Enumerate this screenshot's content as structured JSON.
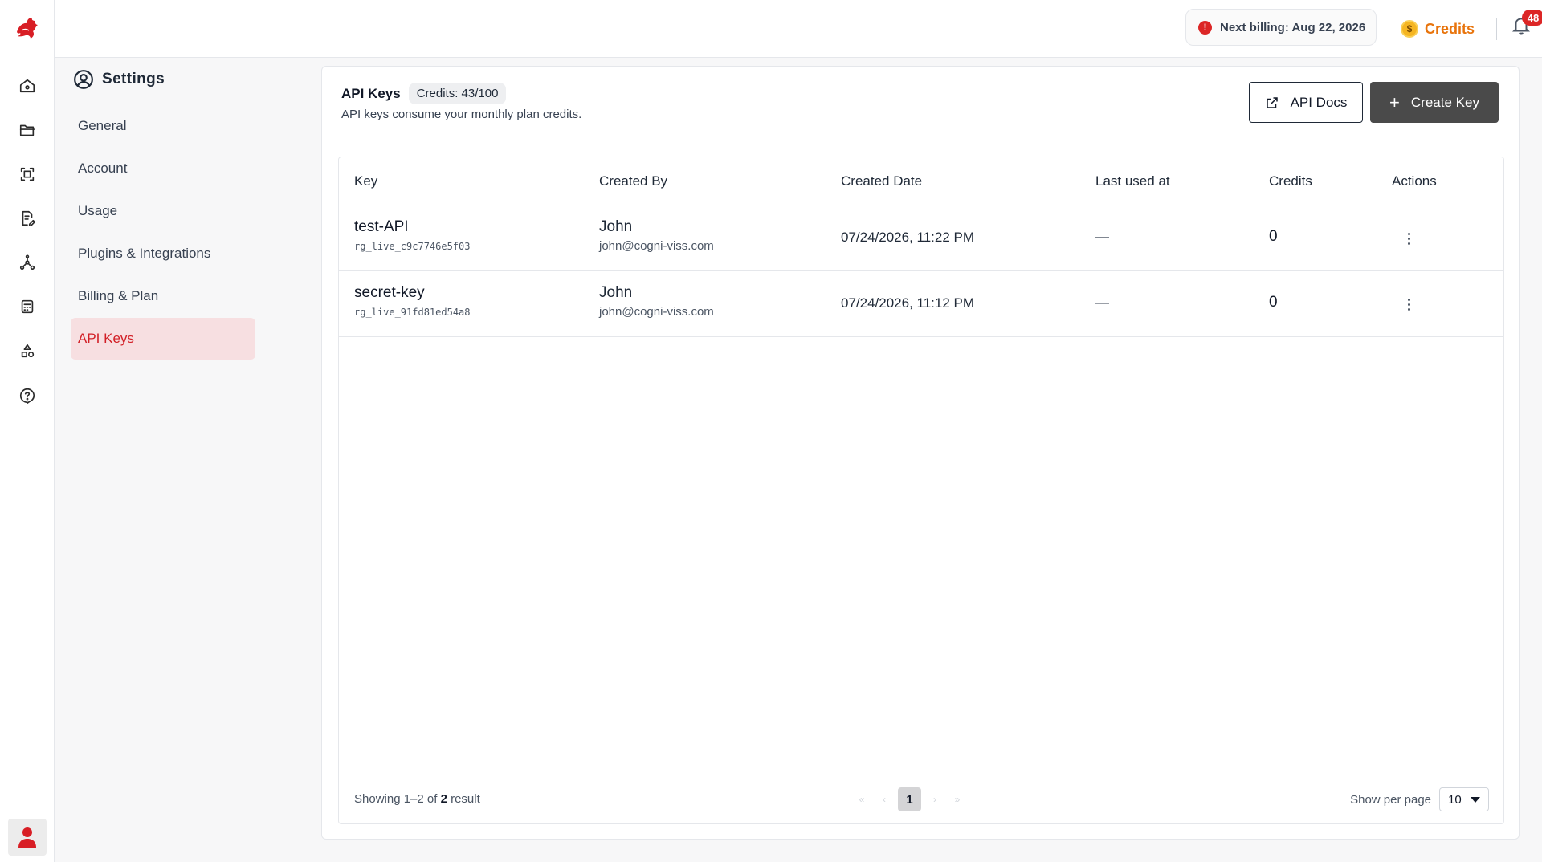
{
  "topbar": {
    "billing_text": "Next billing: Aug 22, 2026",
    "credits_label": "Credits",
    "coin_symbol": "$",
    "notification_count": "48"
  },
  "rail": {
    "icons": [
      "home-icon",
      "folder-icon",
      "scan-icon",
      "document-edit-icon",
      "workflow-icon",
      "calculator-icon",
      "shapes-icon",
      "help-circle-icon"
    ]
  },
  "settings": {
    "title": "Settings",
    "menu": [
      {
        "label": "General",
        "active": false
      },
      {
        "label": "Account",
        "active": false
      },
      {
        "label": "Usage",
        "active": false
      },
      {
        "label": "Plugins & Integrations",
        "active": false
      },
      {
        "label": "Billing & Plan",
        "active": false
      },
      {
        "label": "API Keys",
        "active": true
      }
    ]
  },
  "panel": {
    "title": "API Keys",
    "credits_chip": "Credits: 43/100",
    "subtitle": "API keys consume your monthly plan credits.",
    "docs_button": "API Docs",
    "create_button": "Create Key"
  },
  "table": {
    "columns": [
      "Key",
      "Created By",
      "Created Date",
      "Last used at",
      "Credits",
      "Actions"
    ],
    "rows": [
      {
        "name": "test-API",
        "key_id": "rg_live_c9c7746e5f03",
        "created_by": "John",
        "email": "john@cogni-viss.com",
        "created_date": "07/24/2026, 11:22 PM",
        "last_used": "—",
        "credits": "0"
      },
      {
        "name": "secret-key",
        "key_id": "rg_live_91fd81ed54a8",
        "created_by": "John",
        "email": "john@cogni-viss.com",
        "created_date": "07/24/2026, 11:12 PM",
        "last_used": "—",
        "credits": "0"
      }
    ]
  },
  "footer": {
    "showing_prefix": "Showing 1–2 of ",
    "showing_total": "2",
    "showing_suffix": " result",
    "current_page": "1",
    "per_page_label": "Show per page",
    "per_page_value": "10"
  },
  "colors": {
    "brand_red": "#d21f26",
    "credits_orange": "#e8740c",
    "active_menu_bg": "#f7dfe1",
    "create_button_bg": "#4a4a4a"
  }
}
